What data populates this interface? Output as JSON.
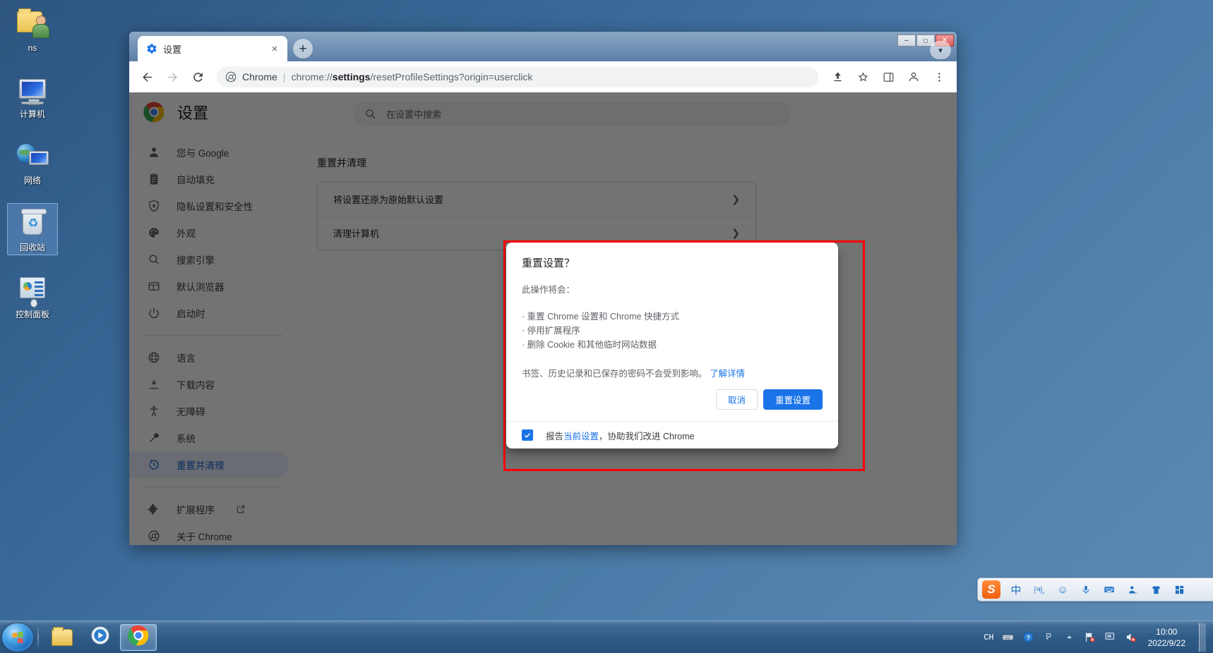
{
  "desktop": {
    "icons": [
      {
        "label": "ns",
        "icon": "folder-user-icon"
      },
      {
        "label": "计算机",
        "icon": "computer-icon"
      },
      {
        "label": "网络",
        "icon": "network-icon"
      },
      {
        "label": "回收站",
        "icon": "recycle-bin-icon",
        "selected": true
      },
      {
        "label": "控制面板",
        "icon": "control-panel-icon"
      }
    ]
  },
  "browser": {
    "tab": {
      "title": "设置",
      "favicon": "settings-gear-icon",
      "close_label": "×"
    },
    "new_tab_label": "+",
    "window_controls": {
      "minimize": "–",
      "maximize": "❐",
      "close": "✕"
    },
    "nav": {
      "back": "←",
      "forward": "→",
      "reload": "⟳"
    },
    "omnibox": {
      "scheme_label": "Chrome",
      "separator": "|",
      "url_prefix": "chrome://",
      "url_bold": "settings",
      "url_suffix": "/resetProfileSettings?origin=userclick",
      "full_url": "chrome://settings/resetProfileSettings?origin=userclick"
    },
    "toolbar_right": {
      "share": "share-icon",
      "bookmark": "star-icon",
      "sidepanel": "side-panel-icon",
      "profile": "profile-avatar-icon",
      "menu": "three-dot-menu-icon"
    },
    "profile_chip": "profile-chevron-icon"
  },
  "settings": {
    "header": {
      "title": "设置",
      "logo": "chrome-logo-icon"
    },
    "search": {
      "placeholder": "在设置中搜索",
      "value": "",
      "icon": "search-icon"
    },
    "sidebar": {
      "groups": [
        {
          "items": [
            {
              "label": "您与 Google",
              "icon": "person-icon"
            },
            {
              "label": "自动填充",
              "icon": "clipboard-icon"
            },
            {
              "label": "隐私设置和安全性",
              "icon": "shield-icon"
            },
            {
              "label": "外观",
              "icon": "palette-icon"
            },
            {
              "label": "搜索引擎",
              "icon": "search-icon"
            },
            {
              "label": "默认浏览器",
              "icon": "browser-window-icon"
            },
            {
              "label": "启动时",
              "icon": "power-icon"
            }
          ]
        },
        {
          "items": [
            {
              "label": "语言",
              "icon": "globe-icon"
            },
            {
              "label": "下载内容",
              "icon": "download-icon"
            },
            {
              "label": "无障碍",
              "icon": "accessibility-icon"
            },
            {
              "label": "系统",
              "icon": "wrench-icon"
            },
            {
              "label": "重置并清理",
              "icon": "history-restore-icon",
              "active": true
            }
          ]
        },
        {
          "items": [
            {
              "label": "扩展程序",
              "icon": "puzzle-icon",
              "external": "external-link-icon"
            },
            {
              "label": "关于 Chrome",
              "icon": "chrome-logo-icon"
            }
          ]
        }
      ]
    },
    "main": {
      "section_title": "重置并清理",
      "rows": [
        {
          "label": "将设置还原为原始默认设置",
          "chevron": "❯"
        },
        {
          "label": "清理计算机",
          "chevron": "❯"
        }
      ]
    }
  },
  "dialog": {
    "title": "重置设置？",
    "intro": "此操作将会：",
    "bullets": [
      "· 重置 Chrome 设置和 Chrome 快捷方式",
      "· 停用扩展程序",
      "· 删除 Cookie 和其他临时网站数据"
    ],
    "note_text": "书签、历史记录和已保存的密码不会受到影响。",
    "note_link": "了解详情",
    "cancel_label": "取消",
    "confirm_label": "重置设置",
    "checkbox": {
      "checked": true,
      "label_prefix": "报告",
      "label_link": "当前设置",
      "label_suffix": "，协助我们改进 Chrome"
    },
    "highlight_color": "#fb0007",
    "accent_color": "#1a73e8"
  },
  "ime": {
    "logo": "sogou-logo-icon",
    "buttons": [
      {
        "icon": "chinese-mode-icon",
        "glyph": "中"
      },
      {
        "icon": "punctuation-icon",
        "glyph": "゜,"
      },
      {
        "icon": "emoji-icon",
        "glyph": "☺"
      },
      {
        "icon": "voice-input-icon",
        "glyph": "Ἲ4"
      },
      {
        "icon": "keyboard-icon",
        "glyph": "⌨"
      },
      {
        "icon": "user-icon",
        "glyph": "὆4"
      },
      {
        "icon": "skin-icon",
        "glyph": "ὅ5"
      },
      {
        "icon": "toolbox-icon",
        "glyph": "▦"
      }
    ]
  },
  "taskbar": {
    "start_label": "start-orb-icon",
    "apps": [
      {
        "icon": "file-explorer-icon",
        "active": false
      },
      {
        "icon": "media-player-icon",
        "active": false
      },
      {
        "icon": "chrome-icon",
        "active": true
      }
    ],
    "tray": {
      "language": "CH",
      "icons": [
        "keyboard-icon",
        "help-icon",
        "expand-icon",
        "show-hidden-icon",
        "network-error-icon",
        "display-icon",
        "volume-muted-icon"
      ],
      "time": "10:00",
      "date": "2022/9/22"
    }
  }
}
